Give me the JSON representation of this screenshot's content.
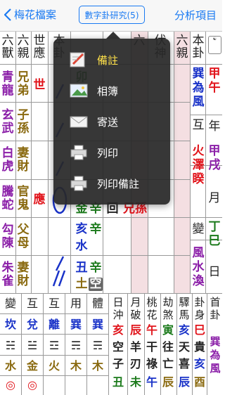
{
  "nav": {
    "back_label": "梅花檔案",
    "center_button": "數字卦研究(5)",
    "right_label": "分析項目"
  },
  "columns": {
    "headers": [
      "六獸",
      "六親",
      "世應",
      "本卦",
      "",
      "變卦",
      "六",
      "伏神",
      "六親",
      "本卦"
    ],
    "beasts": [
      "青龍",
      "玄武",
      "白虎",
      "騰蛇",
      "勾陳",
      "朱雀"
    ],
    "relatives": [
      "兄弟",
      "子孫",
      "妻財",
      "官鬼",
      "父母",
      "妻財"
    ],
    "shi_ying": [
      "世",
      "",
      "",
      "應",
      "",
      ""
    ]
  },
  "right_panel": {
    "gua_name": "巽為風",
    "hu_label": "互",
    "hu_name": "火澤睽",
    "bian_label": "變",
    "bian_name": "風水渙",
    "date_ganzhi": [
      "甲午",
      "年",
      "甲戌",
      "月",
      "丁巳",
      "日"
    ]
  },
  "changed": {
    "rows": [
      {
        "a": "",
        "b": ""
      },
      {
        "a": "",
        "b": ""
      },
      {
        "a": "",
        "b": ""
      },
      {
        "a": "回",
        "b": "兄孫"
      },
      {
        "a": "亥",
        "b": "辛"
      },
      {
        "a": "丑",
        "b": "辛"
      }
    ],
    "extra": [
      {
        "t": "卯",
        "c": "辛"
      },
      {
        "t": "金",
        "c": "辛"
      },
      {
        "t": "水",
        "c": ""
      },
      {
        "t": "土",
        "c": "空"
      }
    ]
  },
  "bottom_table": {
    "headers": [
      "變",
      "互",
      "互",
      "用",
      "體",
      "日沖",
      "月破",
      "桃花",
      "劫煞",
      "驛馬",
      "卦身",
      "首卦"
    ],
    "row1": [
      "坎",
      "兌",
      "離",
      "巽",
      "巽",
      "亥",
      "辰",
      "午",
      "寅",
      "亥",
      "巳",
      "巽"
    ],
    "row2": [
      "☵",
      "☱",
      "☲",
      "☴",
      "☴",
      "空",
      "羊",
      "干",
      "往",
      "天",
      "貴",
      "為"
    ],
    "row3": [
      "水",
      "金",
      "火",
      "木",
      "木",
      "子",
      "刃",
      "祿",
      "亡",
      "喜",
      "亥",
      "風"
    ],
    "row4": [
      "◎",
      "◎",
      "",
      "",
      "",
      "丑",
      "未",
      "午",
      "辰",
      "辰",
      "酉",
      ""
    ]
  },
  "menu": {
    "items": [
      {
        "label": "備註",
        "icon": "pencil-icon",
        "highlight": true
      },
      {
        "label": "相簿",
        "icon": "photo-icon",
        "highlight": false
      },
      {
        "label": "寄送",
        "icon": "envelope-icon",
        "highlight": false
      },
      {
        "label": "列印",
        "icon": "printer-icon",
        "highlight": false
      },
      {
        "label": "列印備註",
        "icon": "printer-note-icon",
        "highlight": false
      }
    ]
  },
  "colors": {
    "accent": "#1a7af2",
    "red": "#e1141b",
    "purple": "#8b1fa8",
    "blue": "#1932c8",
    "olive": "#8a6a10",
    "green": "#1b7a1b"
  }
}
